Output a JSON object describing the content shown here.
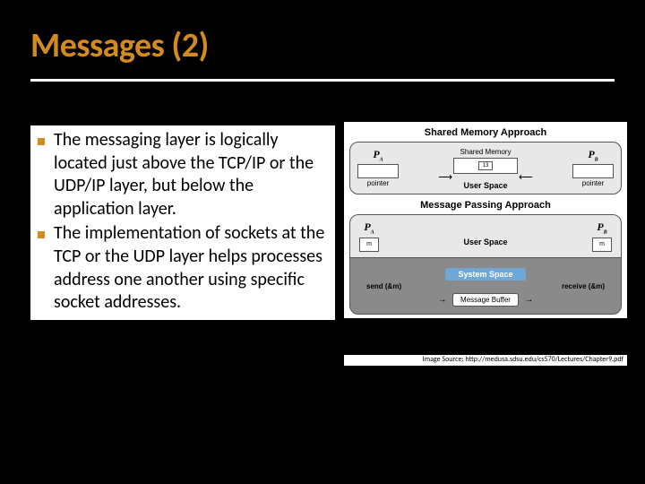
{
  "title": "Messages (2)",
  "bullets": [
    "The messaging layer is logically located just above the TCP/IP or the UDP/IP layer, but below the application layer.",
    "The implementation of sockets at the TCP or the UDP layer helps processes address one another using specific socket addresses."
  ],
  "figure": {
    "approach1_title": "Shared Memory Approach",
    "approach2_title": "Message Passing Approach",
    "proc_a": "P",
    "proc_a_sub": "A",
    "proc_b": "P",
    "proc_b_sub": "B",
    "pointer_label": "pointer",
    "shared_memory_label": "Shared Memory",
    "shared_cell": "13",
    "user_space_label": "User Space",
    "m_label": "m",
    "system_space_label": "System Space",
    "send_label": "send (&m)",
    "receive_label": "receive (&m)",
    "message_buffer_label": "Message Buffer"
  },
  "credit": "Image Source: http://medusa.sdsu.edu/cs570/Lectures/Chapter9.pdf"
}
